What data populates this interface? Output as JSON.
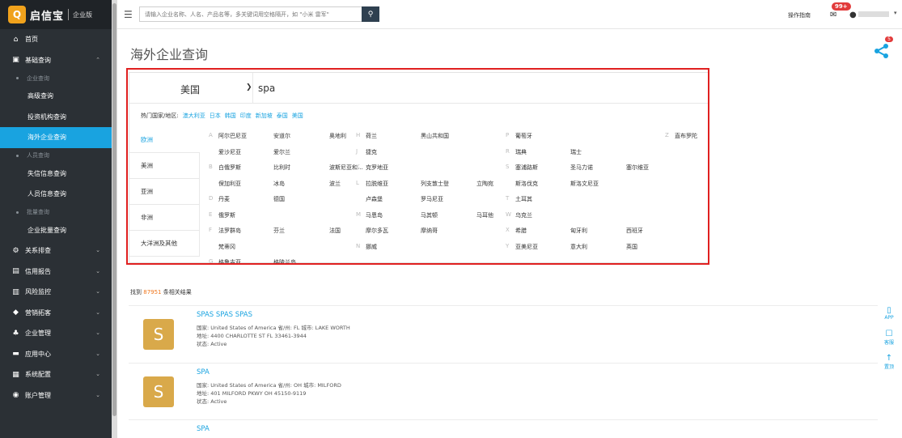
{
  "brand": {
    "mark": "Q",
    "name": "启信宝",
    "edition": "企业版"
  },
  "sidebar": {
    "items": [
      {
        "label": "首页",
        "icon": "home-icon",
        "kind": "top"
      },
      {
        "label": "基础查询",
        "icon": "query-icon",
        "kind": "top",
        "chevron": "up"
      },
      {
        "label": "企业查询",
        "kind": "group"
      },
      {
        "label": "高级查询",
        "kind": "sub"
      },
      {
        "label": "投资机构查询",
        "kind": "sub"
      },
      {
        "label": "海外企业查询",
        "kind": "sub",
        "active": true
      },
      {
        "label": "人员查询",
        "kind": "group"
      },
      {
        "label": "失信信息查询",
        "kind": "sub"
      },
      {
        "label": "人员信息查询",
        "kind": "sub"
      },
      {
        "label": "批量查询",
        "kind": "group"
      },
      {
        "label": "企业批量查询",
        "kind": "sub"
      },
      {
        "label": "关系排查",
        "icon": "relation-icon",
        "kind": "top",
        "chevron": "down"
      },
      {
        "label": "信用报告",
        "icon": "report-icon",
        "kind": "top",
        "chevron": "down"
      },
      {
        "label": "风险监控",
        "icon": "monitor-icon",
        "kind": "top",
        "chevron": "down"
      },
      {
        "label": "营销拓客",
        "icon": "marketing-icon",
        "kind": "top",
        "chevron": "down"
      },
      {
        "label": "企业管理",
        "icon": "org-icon",
        "kind": "top",
        "chevron": "down"
      },
      {
        "label": "应用中心",
        "icon": "app-center-icon",
        "kind": "top",
        "chevron": "down"
      },
      {
        "label": "系统配置",
        "icon": "config-icon",
        "kind": "top",
        "chevron": "down"
      },
      {
        "label": "账户管理",
        "icon": "account-icon",
        "kind": "top",
        "chevron": "down"
      }
    ]
  },
  "topbar": {
    "search_placeholder": "请输入企业名称、人名、产品名等，多关键词用空格隔开，如 \"小米 雷军\"",
    "guide_label": "操作指南",
    "mail_badge": "99+"
  },
  "page": {
    "title": "海外企业查询",
    "share_count": "5"
  },
  "filter": {
    "country": "美国",
    "keyword": "spa",
    "hot_label": "热门国家/地区:",
    "hot_countries": [
      "澳大利亚",
      "日本",
      "韩国",
      "印度",
      "新加坡",
      "泰国",
      "美国"
    ],
    "regions": [
      {
        "label": "欧洲",
        "active": true
      },
      {
        "label": "美洲"
      },
      {
        "label": "亚洲"
      },
      {
        "label": "非洲"
      },
      {
        "label": "大洋洲及其他"
      }
    ],
    "letters": [
      "A",
      "B",
      "D",
      "E",
      "F",
      "G",
      "H",
      "J",
      "K",
      "L",
      "M",
      "N",
      "P",
      "R",
      "S",
      "T",
      "W",
      "X",
      "Y",
      "Z"
    ],
    "countries": {
      "A": [
        "阿尔巴尼亚",
        "安道尔",
        "奥地利",
        "爱沙尼亚",
        "爱尔兰"
      ],
      "B": [
        "白俄罗斯",
        "比利时",
        "波斯尼亚和...",
        "保加利亚",
        "冰岛",
        "波兰"
      ],
      "D": [
        "丹麦",
        "德国"
      ],
      "E": [
        "俄罗斯"
      ],
      "F": [
        "法罗群岛",
        "芬兰",
        "法国",
        "梵蒂冈"
      ],
      "G": [
        "格鲁吉亚",
        "格陵兰岛"
      ],
      "H": [
        "荷兰",
        "黑山共和国"
      ],
      "J": [
        "捷克"
      ],
      "K": [
        "克罗地亚"
      ],
      "L": [
        "拉脱维亚",
        "列支敦士登",
        "立陶宛",
        "卢森堡",
        "罗马尼亚"
      ],
      "M": [
        "马恩岛",
        "马其顿",
        "马耳他",
        "摩尔多瓦",
        "摩纳哥"
      ],
      "N": [
        "挪威"
      ],
      "P": [
        "葡萄牙"
      ],
      "R": [
        "瑞典",
        "瑞士"
      ],
      "S": [
        "塞浦路斯",
        "圣马力诺",
        "塞尔维亚",
        "斯洛伐克",
        "斯洛文尼亚"
      ],
      "T": [
        "土耳其"
      ],
      "W": [
        "乌克兰"
      ],
      "X": [
        "希腊",
        "匈牙利",
        "西班牙"
      ],
      "Y": [
        "亚美尼亚",
        "意大利",
        "英国"
      ],
      "Z": [
        "直布罗陀"
      ]
    }
  },
  "results": {
    "prefix": "找到",
    "count": "87951",
    "suffix": "条相关结果",
    "items": [
      {
        "avatar": "S",
        "name": "SPAS SPAS SPAS",
        "line1": "国家: United States of America   省/州: FL   城市: LAKE WORTH",
        "line2": "地址: 4400 CHARLOTTE ST FL 33461-3944",
        "line3": "状态: Active"
      },
      {
        "avatar": "S",
        "name": "SPA",
        "line1": "国家: United States of America   省/州: OH   城市: MILFORD",
        "line2": "地址: 401 MILFORD PKWY OH 45150-9119",
        "line3": "状态: Active"
      },
      {
        "avatar": "",
        "name": "SPA",
        "line1": "",
        "line2": "",
        "line3": ""
      }
    ]
  },
  "right_tools": [
    {
      "label": "APP",
      "icon": "mobile-icon"
    },
    {
      "label": "客服",
      "icon": "chat-icon"
    },
    {
      "label": "置顶",
      "icon": "arrow-up-icon"
    }
  ],
  "colors": {
    "accent": "#19a3e0",
    "sidebar": "#2b3035",
    "highlight": "#e02020",
    "avatar": "#d9a94a",
    "count": "#f0771e"
  }
}
